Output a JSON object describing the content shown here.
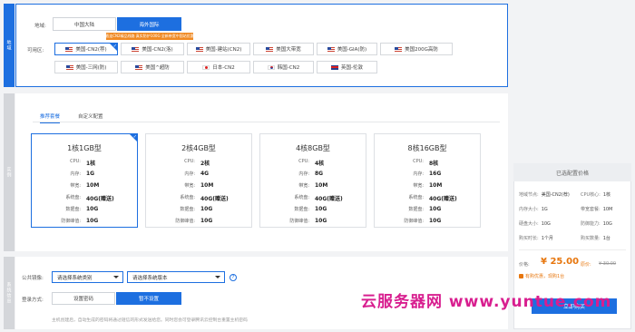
{
  "region_section": {
    "bar_label": "地域",
    "region_label": "地域:",
    "region_tabs": [
      "中国大陆",
      "海外国际"
    ],
    "promo": "直连CN2精品线路 真实防护100G 全新带宽中国站优惠",
    "zone_label": "可用区:",
    "zones_row1": [
      "美国-CN2(荐)",
      "美国-CN2(洛)",
      "美国-建站(CN2)",
      "美国大带宽",
      "美国-GIA(防)",
      "美国200G高防"
    ],
    "zones_row2": [
      "美国-三网(防)",
      "美国^超防",
      "日本-CN2",
      "韩国-CN2",
      "英国-伦敦"
    ]
  },
  "config_section": {
    "bar_label": "实例",
    "tabs": [
      "推荐套餐",
      "自定义配置"
    ],
    "spec_keys": [
      "CPU:",
      "内存:",
      "带宽:",
      "系统盘:",
      "数据盘:",
      "防御峰值:"
    ],
    "plans": [
      {
        "title": "1核1GB型",
        "values": [
          "1核",
          "1G",
          "10M",
          "40G(赠送)",
          "10G",
          "10G"
        ]
      },
      {
        "title": "2核4GB型",
        "values": [
          "2核",
          "4G",
          "10M",
          "40G(赠送)",
          "10G",
          "10G"
        ]
      },
      {
        "title": "4核8GB型",
        "values": [
          "4核",
          "8G",
          "10M",
          "40G(赠送)",
          "10G",
          "10G"
        ]
      },
      {
        "title": "8核16GB型",
        "values": [
          "8核",
          "16G",
          "10M",
          "40G(赠送)",
          "10G",
          "10G"
        ]
      }
    ]
  },
  "system_section": {
    "bar_label": "系统信息",
    "image_label": "公共镜像:",
    "os_type_placeholder": "请选择系统类别",
    "os_version_placeholder": "请选择系统版本",
    "help_icon_text": "?",
    "login_label": "登录方式:",
    "login_options": [
      "设置密码",
      "暂不设置"
    ],
    "note": "主机创建后，自动生成的密码将通过短信的形式发送给您。同时您会可登录腾讯云控制台重置主机密码"
  },
  "summary": {
    "title": "已选配置价格",
    "rows": [
      [
        "地域节点:",
        "美国-CN2(荐)",
        "CPU核心:",
        "1核"
      ],
      [
        "内存大小:",
        "1G",
        "带宽套餐:",
        "10M"
      ],
      [
        "硬盘大小:",
        "10G",
        "防御能力:",
        "10G"
      ],
      [
        "购买时长:",
        "1个月",
        "购买数量:",
        "1台"
      ]
    ],
    "price_label": "价格:",
    "price": "¥ 25.00",
    "discount_label": "原价:",
    "original_price": "¥ 30.00",
    "promo_line": "有购优惠，现购1台",
    "buy_button": "立即购买"
  },
  "watermark": "云服务器网 www.yuntue.com",
  "colors": {
    "accent": "#1d6fe0",
    "price": "#e7760d",
    "watermark": "#d81e8f"
  }
}
